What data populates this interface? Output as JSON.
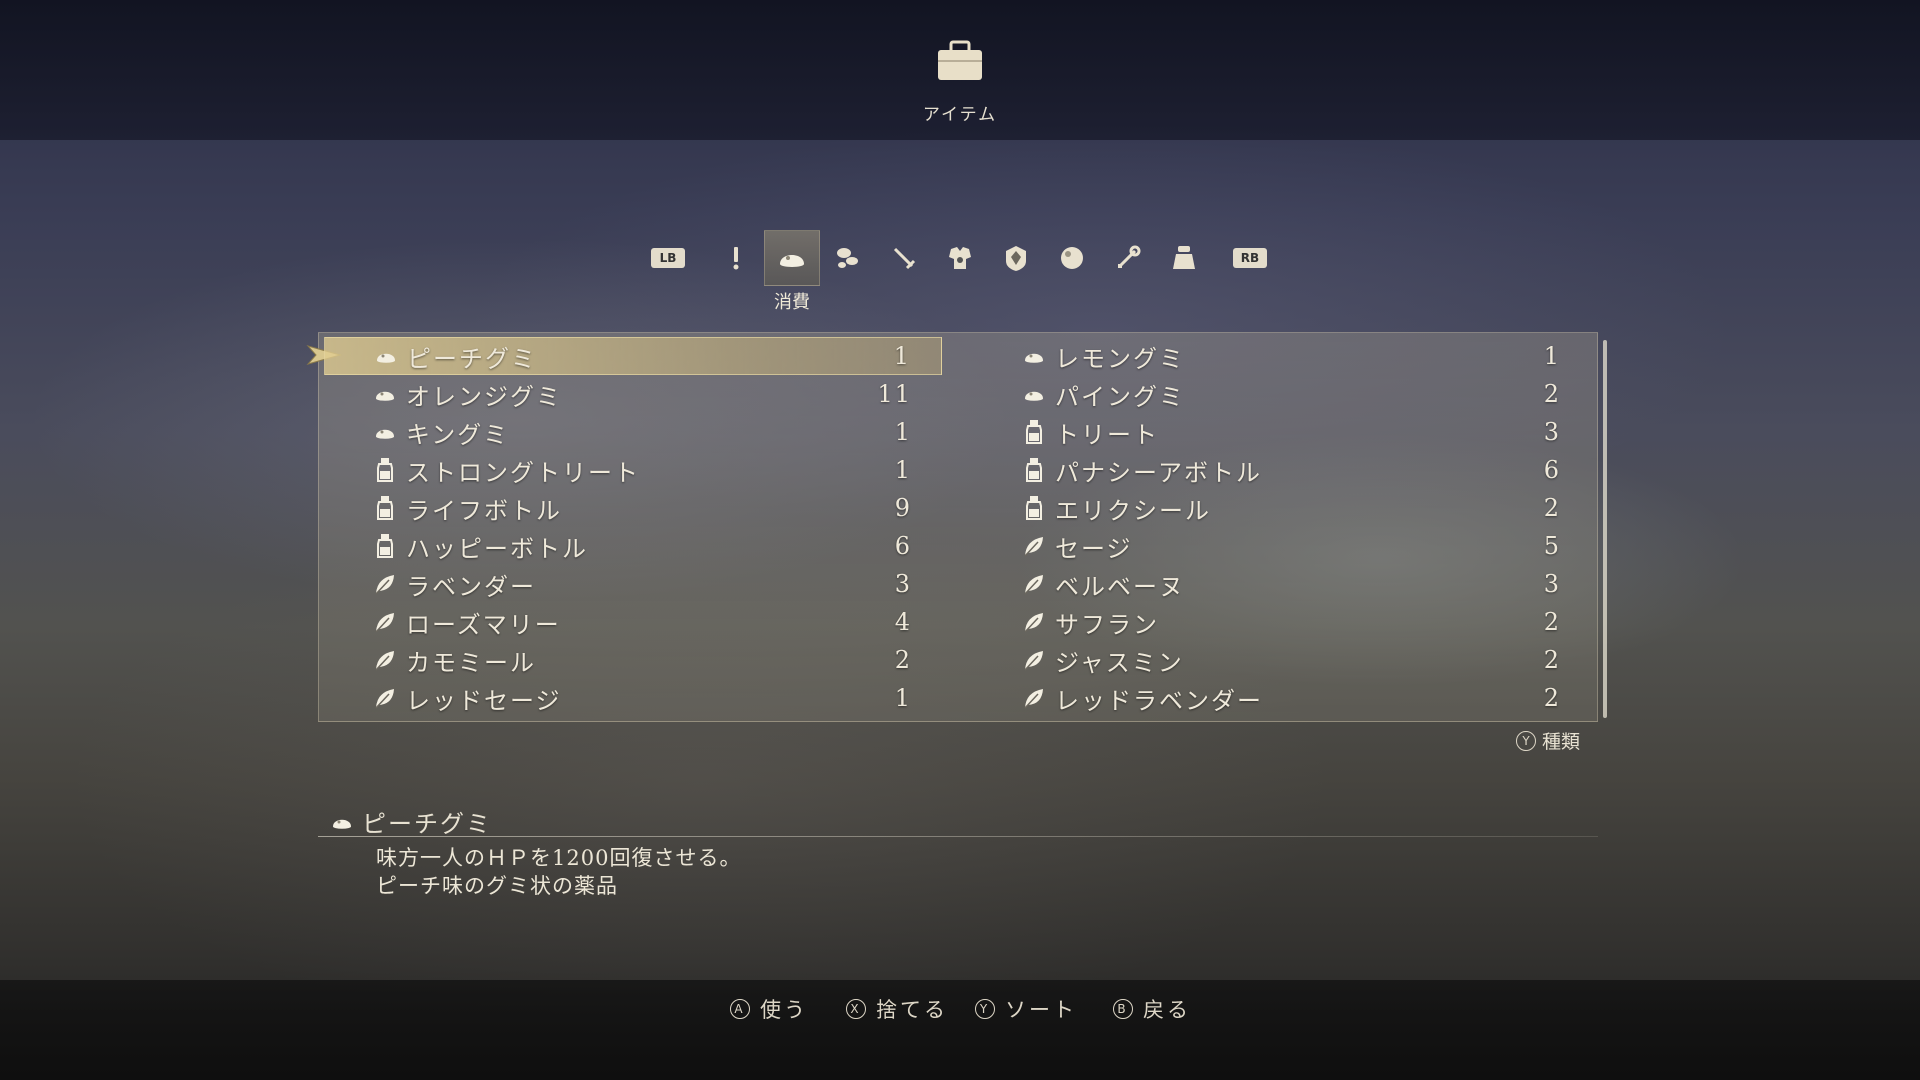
{
  "header": {
    "title": "アイテム",
    "icon": "bag-icon"
  },
  "tabs": {
    "lb_label": "LB",
    "rb_label": "RB",
    "active_caption": "消費",
    "items": [
      {
        "icon": "exclamation-icon"
      },
      {
        "icon": "gummy-icon"
      },
      {
        "icon": "ingredients-icon"
      },
      {
        "icon": "sword-icon"
      },
      {
        "icon": "armor-icon"
      },
      {
        "icon": "shield-icon"
      },
      {
        "icon": "orb-icon"
      },
      {
        "icon": "key-icon"
      },
      {
        "icon": "pouch-icon"
      }
    ],
    "active_index": 1
  },
  "items_left": [
    {
      "name": "ピーチグミ",
      "qty": "1",
      "icon": "gummy"
    },
    {
      "name": "オレンジグミ",
      "qty": "11",
      "icon": "gummy"
    },
    {
      "name": "キングミ",
      "qty": "1",
      "icon": "gummy"
    },
    {
      "name": "ストロングトリート",
      "qty": "1",
      "icon": "bottle"
    },
    {
      "name": "ライフボトル",
      "qty": "9",
      "icon": "bottle"
    },
    {
      "name": "ハッピーボトル",
      "qty": "6",
      "icon": "bottle"
    },
    {
      "name": "ラベンダー",
      "qty": "3",
      "icon": "leaf"
    },
    {
      "name": "ローズマリー",
      "qty": "4",
      "icon": "leaf"
    },
    {
      "name": "カモミール",
      "qty": "2",
      "icon": "leaf"
    },
    {
      "name": "レッドセージ",
      "qty": "1",
      "icon": "leaf"
    }
  ],
  "items_right": [
    {
      "name": "レモングミ",
      "qty": "1",
      "icon": "gummy"
    },
    {
      "name": "パイングミ",
      "qty": "2",
      "icon": "gummy"
    },
    {
      "name": "トリート",
      "qty": "3",
      "icon": "bottle"
    },
    {
      "name": "パナシーアボトル",
      "qty": "6",
      "icon": "bottle"
    },
    {
      "name": "エリクシール",
      "qty": "2",
      "icon": "bottle"
    },
    {
      "name": "セージ",
      "qty": "5",
      "icon": "leaf"
    },
    {
      "name": "ベルベーヌ",
      "qty": "3",
      "icon": "leaf"
    },
    {
      "name": "サフラン",
      "qty": "2",
      "icon": "leaf"
    },
    {
      "name": "ジャスミン",
      "qty": "2",
      "icon": "leaf"
    },
    {
      "name": "レッドラベンダー",
      "qty": "2",
      "icon": "leaf"
    }
  ],
  "type_hint": {
    "button": "Y",
    "label": "種類"
  },
  "description": {
    "name": "ピーチグミ",
    "line1": "味方一人のＨＰを1200回復させる。",
    "line2": "ピーチ味のグミ状の薬品"
  },
  "actions": [
    {
      "button": "A",
      "label": "使う"
    },
    {
      "button": "X",
      "label": "捨てる"
    },
    {
      "button": "Y",
      "label": "ソート"
    },
    {
      "button": "B",
      "label": "戻る"
    }
  ],
  "colors": {
    "accent": "#d8c78f",
    "text": "#efe9da"
  }
}
